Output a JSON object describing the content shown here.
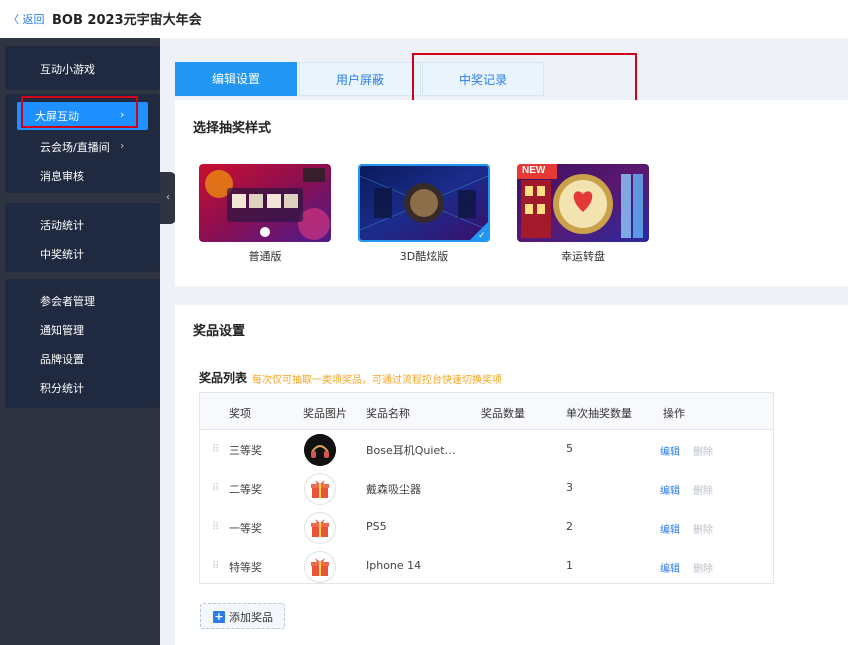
{
  "header": {
    "back_label": "〈 返回",
    "title": "BOB 2023元宇宙大年会"
  },
  "sidebar": {
    "groups": [
      {
        "items": [
          {
            "label": "互动小游戏"
          }
        ]
      },
      {
        "items": [
          {
            "label": "大屏互动",
            "active": true,
            "arrow": "›"
          },
          {
            "label": "云会场/直播间",
            "arrow": "›"
          },
          {
            "label": "消息审核"
          }
        ]
      },
      {
        "items": [
          {
            "label": "活动统计"
          },
          {
            "label": "中奖统计"
          }
        ]
      },
      {
        "items": [
          {
            "label": "参会者管理"
          },
          {
            "label": "通知管理"
          },
          {
            "label": "品牌设置"
          },
          {
            "label": "积分统计"
          }
        ]
      }
    ],
    "collapse_glyph": "‹"
  },
  "tabs": [
    {
      "label": "编辑设置",
      "active": true
    },
    {
      "label": "用户屏蔽",
      "active": false
    },
    {
      "label": "中奖记录",
      "active": false
    }
  ],
  "lottery_style": {
    "title": "选择抽奖样式",
    "options": [
      {
        "caption": "普通版",
        "selected": false,
        "new": false
      },
      {
        "caption": "3D酷炫版",
        "selected": true,
        "new": false
      },
      {
        "caption": "幸运转盘",
        "selected": false,
        "new": true,
        "badge": "NEW"
      }
    ]
  },
  "prize_settings": {
    "title": "奖品设置",
    "list_title": "奖品列表",
    "list_note": "每次仅可抽取一类项奖品，可通过流程控台快速切换奖项",
    "columns": [
      "奖项",
      "奖品图片",
      "奖品名称",
      "奖品数量",
      "单次抽奖数量",
      "操作"
    ],
    "rows": [
      {
        "level": "三等奖",
        "name": "Bose耳机Quiet…",
        "quantity": "",
        "per_draw": "5",
        "image": "headphones"
      },
      {
        "level": "二等奖",
        "name": "戴森吸尘器",
        "quantity": "",
        "per_draw": "3",
        "image": "gift"
      },
      {
        "level": "一等奖",
        "name": "PS5",
        "quantity": "",
        "per_draw": "2",
        "image": "gift"
      },
      {
        "level": "特等奖",
        "name": "Iphone 14",
        "quantity": "",
        "per_draw": "1",
        "image": "gift"
      }
    ],
    "edit_label": "编辑",
    "delete_label": "删除",
    "drag_glyph": "⠿",
    "add_label": "添加奖品"
  },
  "colors": {
    "accent": "#2196f3",
    "sidebar_bg": "#1f2a40",
    "highlight": "#d0021b",
    "note": "#f5a623"
  }
}
